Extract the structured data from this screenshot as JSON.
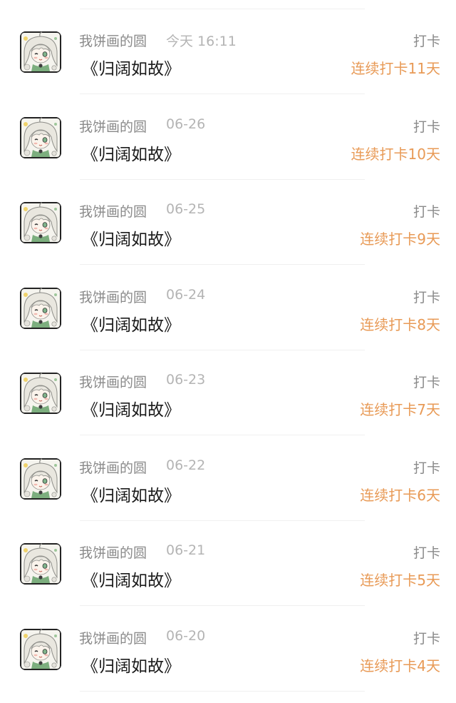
{
  "entries": [
    {
      "user": "我饼画的圆",
      "date": "今天 16:11",
      "title": "《归阔如故》",
      "action": "打卡",
      "streak": "连续打卡11天"
    },
    {
      "user": "我饼画的圆",
      "date": "06-26",
      "title": "《归阔如故》",
      "action": "打卡",
      "streak": "连续打卡10天"
    },
    {
      "user": "我饼画的圆",
      "date": "06-25",
      "title": "《归阔如故》",
      "action": "打卡",
      "streak": "连续打卡9天"
    },
    {
      "user": "我饼画的圆",
      "date": "06-24",
      "title": "《归阔如故》",
      "action": "打卡",
      "streak": "连续打卡8天"
    },
    {
      "user": "我饼画的圆",
      "date": "06-23",
      "title": "《归阔如故》",
      "action": "打卡",
      "streak": "连续打卡7天"
    },
    {
      "user": "我饼画的圆",
      "date": "06-22",
      "title": "《归阔如故》",
      "action": "打卡",
      "streak": "连续打卡6天"
    },
    {
      "user": "我饼画的圆",
      "date": "06-21",
      "title": "《归阔如故》",
      "action": "打卡",
      "streak": "连续打卡5天"
    },
    {
      "user": "我饼画的圆",
      "date": "06-20",
      "title": "《归阔如故》",
      "action": "打卡",
      "streak": "连续打卡4天"
    }
  ],
  "colors": {
    "streak": "#e89a56",
    "username": "#8a8a8a",
    "date": "#b4b4b4",
    "title": "#1a1a1a",
    "divider": "#f0f0f0"
  },
  "icons": {
    "avatar": "anime-character-avatar-icon"
  }
}
